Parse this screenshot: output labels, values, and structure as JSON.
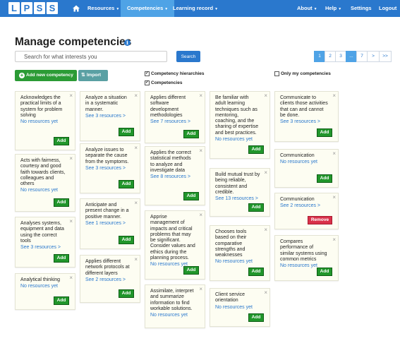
{
  "nav": {
    "logo": [
      "L",
      "P",
      "S",
      "S"
    ],
    "resources": "Resources",
    "competencies": "Competencies",
    "learning_record": "Learning record",
    "about": "About",
    "help": "Help",
    "settings": "Settings",
    "logout": "Logout"
  },
  "page": {
    "title": "Manage competencies",
    "info_glyph": "i"
  },
  "search": {
    "placeholder": "Search for what interests you",
    "button": "Search"
  },
  "pager": [
    "1",
    "2",
    "3",
    "...",
    "7",
    ">",
    ">>"
  ],
  "toolbar": {
    "add_new": "Add new competency",
    "import": "Import",
    "hierarchies": "Competency hierarchies",
    "competencies": "Competencies",
    "only_mine": "Only my competencies"
  },
  "cards": [
    {
      "title": "Acknowledges the practical limits of a system for problem solving",
      "res": "No resources yet",
      "btn": "Add"
    },
    {
      "title": "Acts with fairness, courtesy and good faith towards clients, colleagues and others",
      "res": "No resources yet",
      "btn": "Add"
    },
    {
      "title": "Analyses systems, equipment and data using the correct tools",
      "res": "See 3 resources >",
      "btn": "Add"
    },
    {
      "title": "Analytical thinking",
      "res": "No resources yet",
      "btn": "Add"
    },
    {
      "title": "Analyze a situation in a systematic manner.",
      "res": "See 3 resources >",
      "btn": "Add"
    },
    {
      "title": "Analyze issues to separate the cause from the symptoms.",
      "res": "See 3 resources >",
      "btn": "Add"
    },
    {
      "title": "Anticipate and present change in a positive manner.",
      "res": "See 1 resources >",
      "btn": "Add"
    },
    {
      "title": "Applies different network protocols at different layers",
      "res": "See 2 resources >",
      "btn": "Add"
    },
    {
      "title": "Applies different software development methodologies",
      "res": "See 7 resources >",
      "btn": "Add"
    },
    {
      "title": "Applies the correct statistical methods to analyze and investigate data",
      "res": "See 8 resources >",
      "btn": "Add"
    },
    {
      "title": "Apprise management of impacts and critical problems that may be significant. Consider values and ethics during the planning process.",
      "res": "No resources yet",
      "btn": "Add"
    },
    {
      "title": "Assimilate, interpret and summarize information to find workable solutions.",
      "res": "No resources yet",
      "btn": "Add"
    },
    {
      "title": "Be familiar with adult learning techniques such as mentoring, coaching, and the sharing of expertise and best practices.",
      "res": "No resources yet",
      "btn": "Add"
    },
    {
      "title": "Build mutual trust by being reliable, consistent and credible.",
      "res": "See 13 resources >",
      "btn": "Add"
    },
    {
      "title": "Chooses tools based on their comparative strengths and weaknesses",
      "res": "No resources yet",
      "btn": "Add"
    },
    {
      "title": "Client service orientation",
      "res": "No resources yet",
      "btn": "Add"
    },
    {
      "title": "Communicate to clients those activities that can and cannot be done.",
      "res": "See 3 resources >",
      "btn": "Add"
    },
    {
      "title": "Communication",
      "res": "No resources yet",
      "btn": "Add"
    },
    {
      "title": "Communication",
      "res": "See 2 resources >",
      "btn": "Remove"
    },
    {
      "title": "Compares performance of similar systems using common metrics",
      "res": "No resources yet",
      "btn": "Add"
    }
  ],
  "colors": {
    "nav": "#2a78cd",
    "nav_active": "#4fa3e6",
    "add_green": "#21962b",
    "remove_red": "#d9314a",
    "card_bg": "#fdfdf2"
  }
}
